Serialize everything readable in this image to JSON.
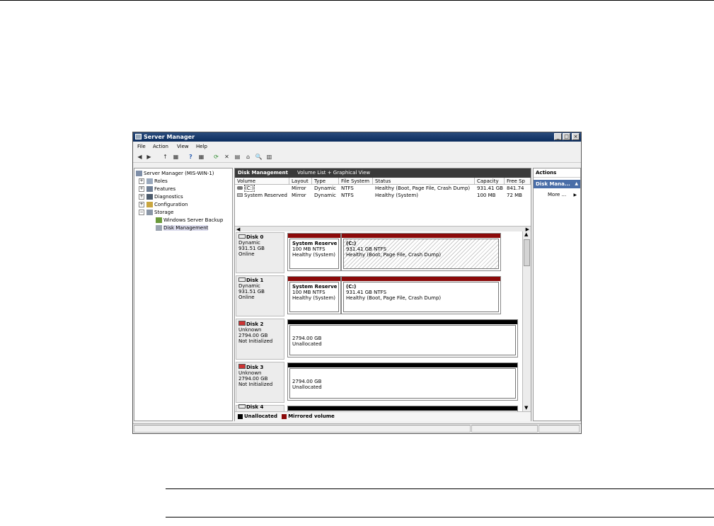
{
  "window": {
    "title": "Server Manager",
    "minimize": "_",
    "maximize": "□",
    "close": "×"
  },
  "menu": [
    "File",
    "Action",
    "View",
    "Help"
  ],
  "tree": {
    "root": "Server Manager (MIS-WIN-1)",
    "roles": "Roles",
    "features": "Features",
    "diagnostics": "Diagnostics",
    "configuration": "Configuration",
    "storage": "Storage",
    "backup": "Windows Server Backup",
    "diskmgmt": "Disk Management",
    "expand_plus": "+",
    "expand_minus": "−"
  },
  "center": {
    "title": "Disk Management",
    "subtitle": "Volume List + Graphical View"
  },
  "volume_table": {
    "headers": [
      "Volume",
      "Layout",
      "Type",
      "File System",
      "Status",
      "Capacity",
      "Free Sp"
    ],
    "rows": [
      [
        "(C:)",
        "Mirror",
        "Dynamic",
        "NTFS",
        "Healthy (Boot, Page File, Crash Dump)",
        "931.41 GB",
        "841.74"
      ],
      [
        "System Reserved",
        "Mirror",
        "Dynamic",
        "NTFS",
        "Healthy (System)",
        "100 MB",
        "72 MB"
      ]
    ]
  },
  "disks": [
    {
      "name": "Disk 0",
      "type": "Dynamic",
      "size": "931.51 GB",
      "state": "Online",
      "parts": [
        {
          "title": "System Reserve",
          "size": "100 MB NTFS",
          "status": "Healthy (System)"
        },
        {
          "title": "(C:)",
          "size": "931.41 GB NTFS",
          "status": "Healthy (Boot, Page File, Crash Dump)"
        }
      ]
    },
    {
      "name": "Disk 1",
      "type": "Dynamic",
      "size": "931.51 GB",
      "state": "Online",
      "parts": [
        {
          "title": "System Reserve",
          "size": "100 MB NTFS",
          "status": "Healthy (System)"
        },
        {
          "title": "(C:)",
          "size": "931.41 GB NTFS",
          "status": "Healthy (Boot, Page File, Crash Dump)"
        }
      ]
    },
    {
      "name": "Disk 2",
      "type": "Unknown",
      "size": "2794.00 GB",
      "state": "Not Initialized",
      "parts": [
        {
          "size": "2794.00 GB",
          "status": "Unallocated"
        }
      ]
    },
    {
      "name": "Disk 3",
      "type": "Unknown",
      "size": "2794.00 GB",
      "state": "Not Initialized",
      "parts": [
        {
          "size": "2794.00 GB",
          "status": "Unallocated"
        }
      ]
    },
    {
      "name": "Disk 4"
    }
  ],
  "legend": {
    "unallocated": "Unallocated",
    "mirrored": "Mirrored volume"
  },
  "actions": {
    "header": "Actions",
    "section": "Disk Mana...",
    "more": "More ...",
    "up_arrow": "▲",
    "right_arrow": "▶"
  },
  "scroll": {
    "left": "◀",
    "right": "▶",
    "up": "▲",
    "down": "▼"
  },
  "toolbar_icons": [
    "◀",
    "▶",
    "↑",
    "▦",
    "?",
    "▦",
    "⟳",
    "✕",
    "▤",
    "⌂",
    "🔍",
    "▥"
  ],
  "colors": {
    "mirrored": "#8b0a0a",
    "unallocated": "#000000",
    "selection": "#4a6ea8"
  }
}
